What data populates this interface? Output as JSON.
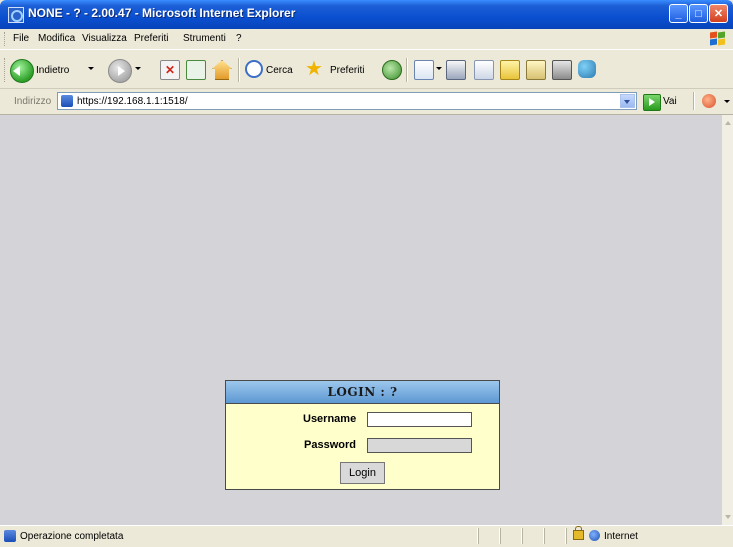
{
  "window": {
    "title": "NONE - ? - 2.00.47 - Microsoft Internet Explorer"
  },
  "menu": {
    "items": [
      "File",
      "Modifica",
      "Visualizza",
      "Preferiti",
      "Strumenti",
      "?"
    ]
  },
  "toolbar": {
    "back_label": "Indietro",
    "search_label": "Cerca",
    "favorites_label": "Preferiti"
  },
  "address": {
    "label": "Indirizzo",
    "url": "https://192.168.1.1:1518/",
    "go_label": "Vai"
  },
  "login": {
    "title": "LOGIN : ?",
    "username_label": "Username",
    "username_value": "",
    "password_label": "Password",
    "password_value": "",
    "button_label": "Login"
  },
  "status": {
    "text": "Operazione completata",
    "zone": "Internet"
  }
}
